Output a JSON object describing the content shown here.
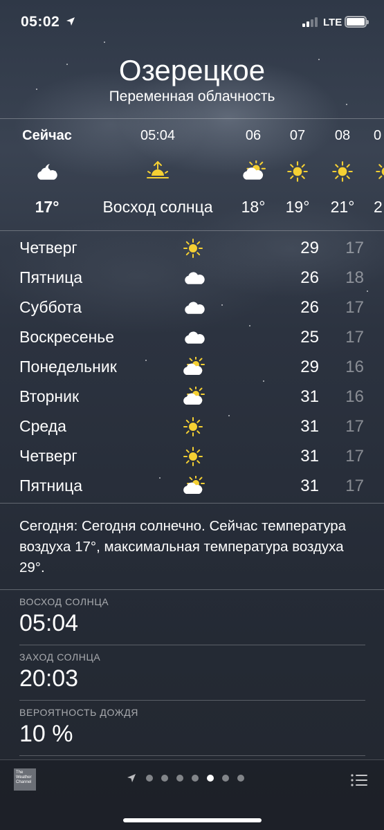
{
  "status_bar": {
    "time": "05:02",
    "network": "LTE"
  },
  "header": {
    "city": "Озерецкое",
    "condition": "Переменная облачность"
  },
  "hourly": [
    {
      "label": "Сейчас",
      "icon": "moon-cloud-icon",
      "temp": "17°",
      "bold": true
    },
    {
      "label": "05:04",
      "icon": "sunrise-icon",
      "temp": "Восход солнца",
      "bold": false
    },
    {
      "label": "06",
      "icon": "sun-cloud-icon",
      "temp": "18°",
      "bold": false
    },
    {
      "label": "07",
      "icon": "sun-icon",
      "temp": "19°",
      "bold": false
    },
    {
      "label": "08",
      "icon": "sun-icon",
      "temp": "21°",
      "bold": false
    },
    {
      "label": "0",
      "icon": "sun-icon",
      "temp": "2",
      "bold": false
    }
  ],
  "daily": [
    {
      "day": "Четверг",
      "icon": "sun-icon",
      "high": "29",
      "low": "17"
    },
    {
      "day": "Пятница",
      "icon": "cloud-icon",
      "high": "26",
      "low": "18"
    },
    {
      "day": "Суббота",
      "icon": "cloud-icon",
      "high": "26",
      "low": "17"
    },
    {
      "day": "Воскресенье",
      "icon": "cloud-icon",
      "high": "25",
      "low": "17"
    },
    {
      "day": "Понедельник",
      "icon": "sun-cloud-icon",
      "high": "29",
      "low": "16"
    },
    {
      "day": "Вторник",
      "icon": "sun-cloud-icon",
      "high": "31",
      "low": "16"
    },
    {
      "day": "Среда",
      "icon": "sun-icon",
      "high": "31",
      "low": "17"
    },
    {
      "day": "Четверг",
      "icon": "sun-icon",
      "high": "31",
      "low": "17"
    },
    {
      "day": "Пятница",
      "icon": "sun-cloud-icon",
      "high": "31",
      "low": "17"
    }
  ],
  "summary": "Сегодня: Сегодня солнечно. Сейчас температура воздуха 17°, максимальная температура воздуха 29°.",
  "details": [
    {
      "label": "ВОСХОД СОЛНЦА",
      "value": "05:04"
    },
    {
      "label": "ЗАХОД СОЛНЦА",
      "value": "20:03"
    },
    {
      "label": "ВЕРОЯТНОСТЬ ДОЖДЯ",
      "value": "10 %"
    }
  ],
  "footer": {
    "provider_lines": [
      "The",
      "Weather",
      "Channel"
    ],
    "page_count": 7,
    "active_page_index": 4
  },
  "colors": {
    "sun": "#f5d033",
    "cloud": "#ffffff"
  }
}
